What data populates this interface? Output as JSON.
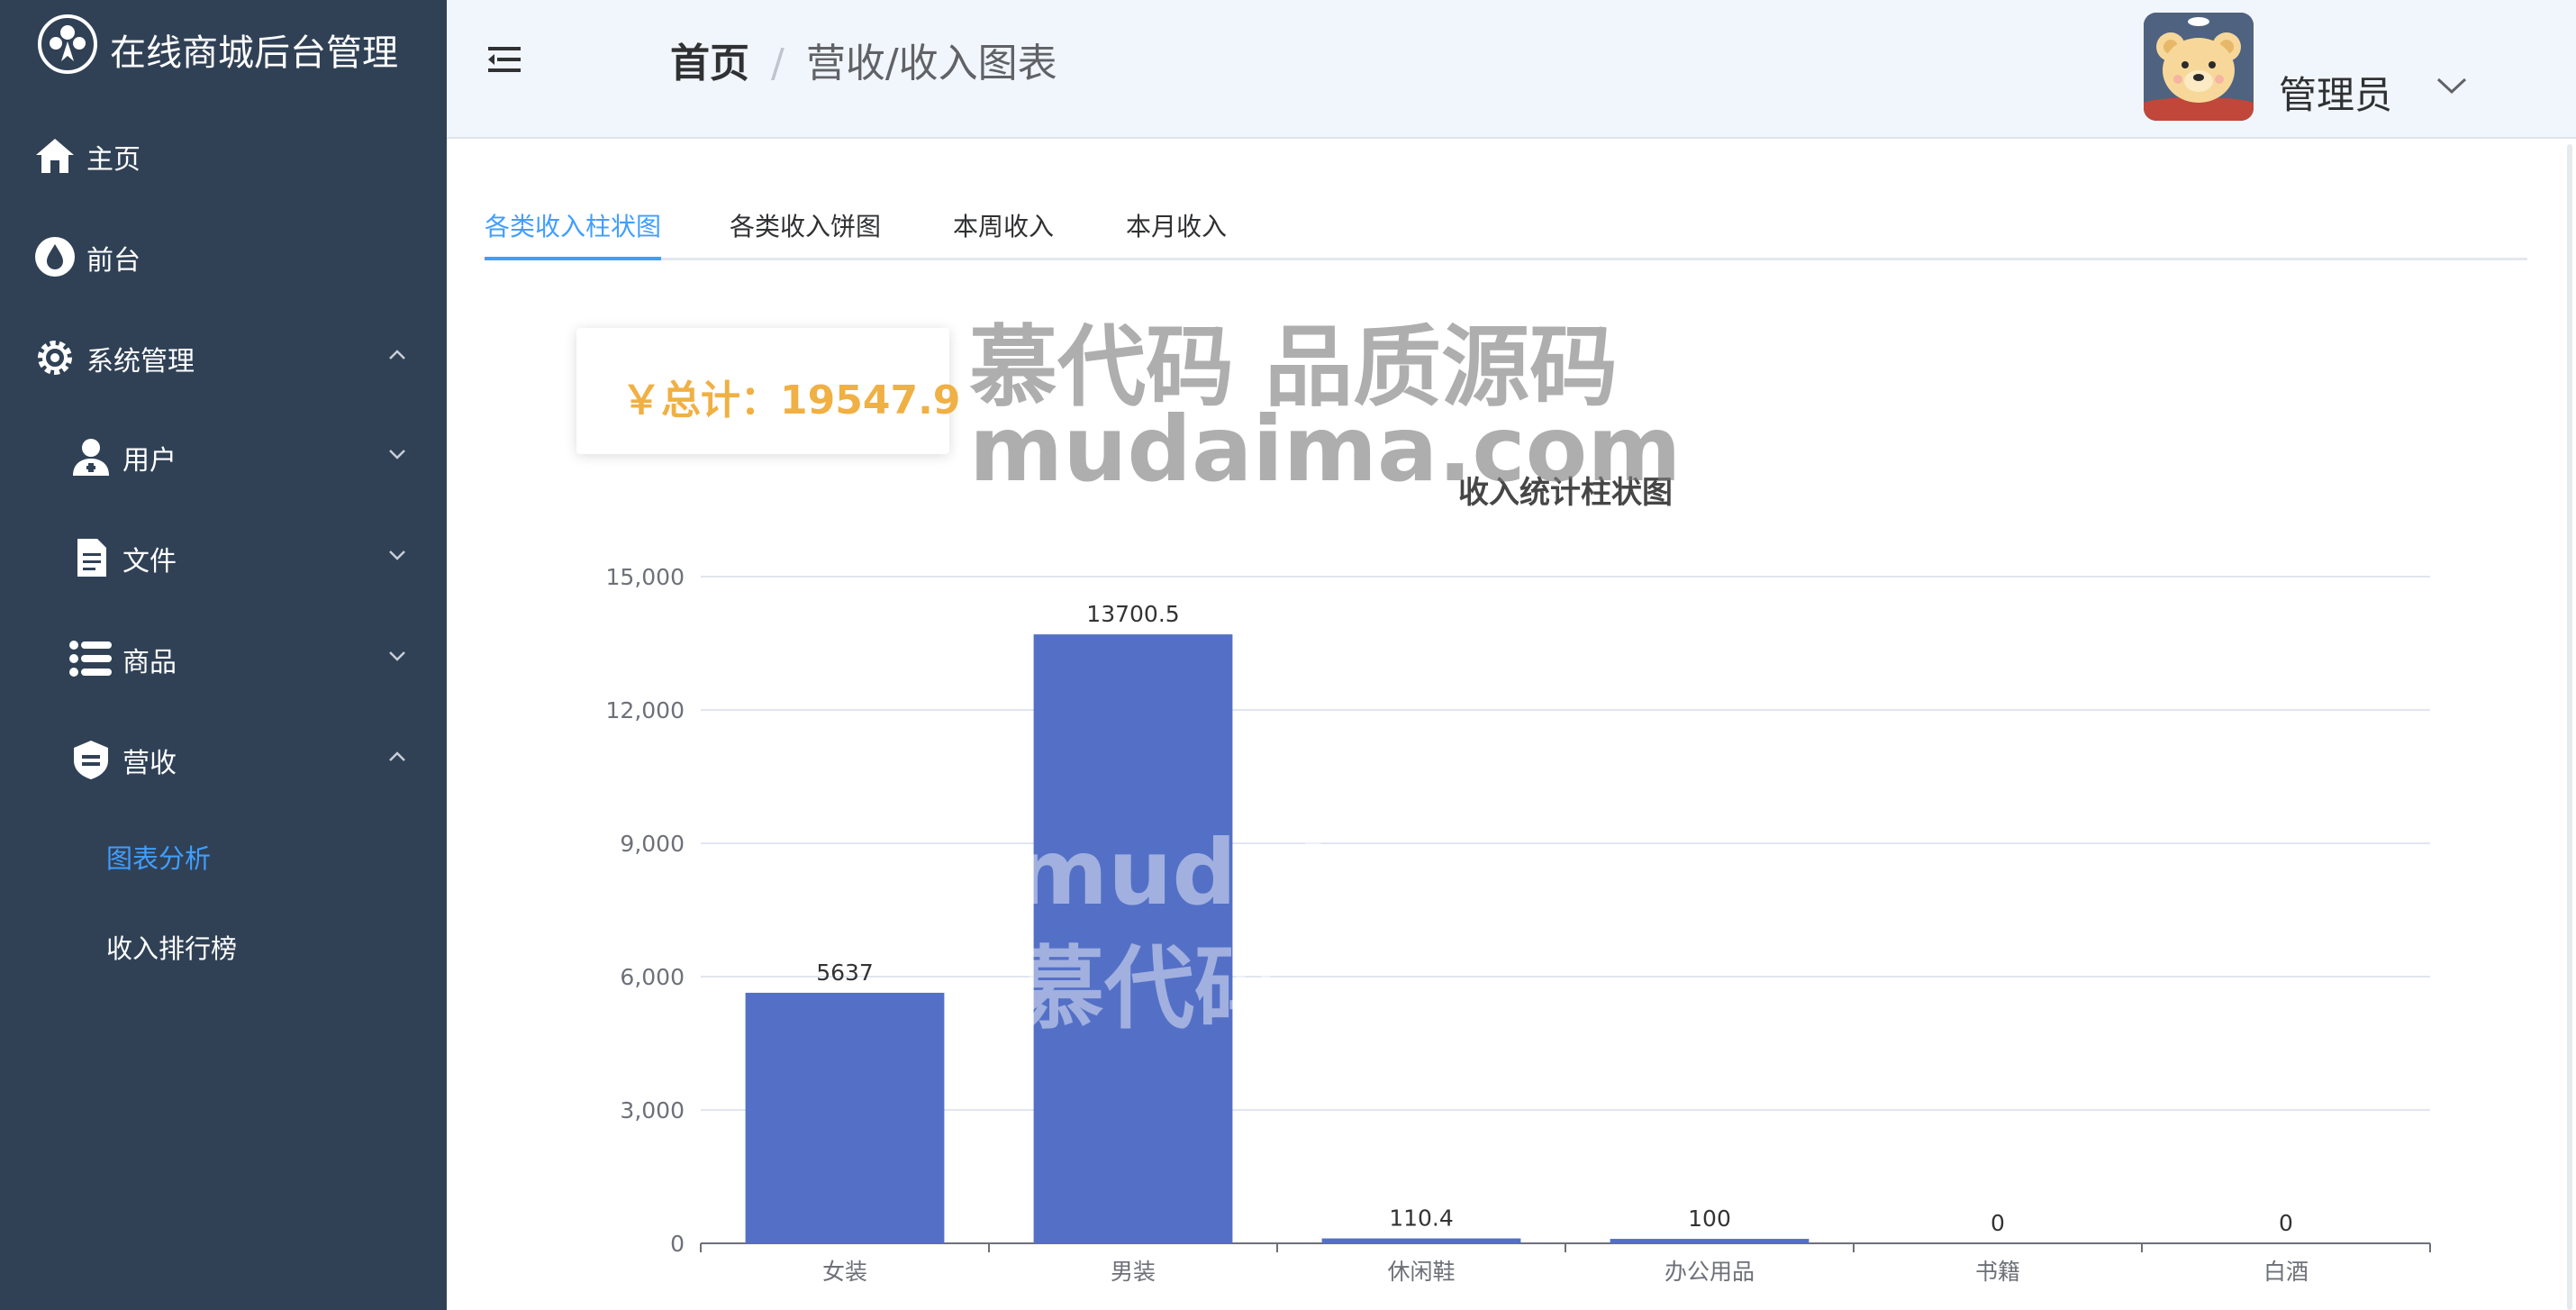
{
  "brand": {
    "title": "在线商城后台管理",
    "logo_icon": "paw-logo-icon"
  },
  "sidebar": {
    "items": [
      {
        "label": "主页",
        "icon": "home-icon"
      },
      {
        "label": "前台",
        "icon": "drop-icon"
      },
      {
        "label": "系统管理",
        "icon": "gear-icon",
        "expanded": true
      },
      {
        "label": "用户",
        "icon": "user-icon",
        "expanded": false
      },
      {
        "label": "文件",
        "icon": "document-icon",
        "expanded": false
      },
      {
        "label": "商品",
        "icon": "list-icon",
        "expanded": false
      },
      {
        "label": "营收",
        "icon": "shield-icon",
        "expanded": true
      }
    ],
    "sub_items": [
      {
        "label": "图表分析",
        "active": true
      },
      {
        "label": "收入排行榜",
        "active": false
      }
    ]
  },
  "header": {
    "breadcrumb_home": "首页",
    "breadcrumb_sep": "/",
    "breadcrumb_current": "营收/收入图表",
    "user_name": "管理员"
  },
  "tabs": [
    {
      "label": "各类收入柱状图",
      "active": true
    },
    {
      "label": "各类收入饼图",
      "active": false
    },
    {
      "label": "本周收入",
      "active": false
    },
    {
      "label": "本月收入",
      "active": false
    }
  ],
  "total": {
    "text": "￥总计：19547.9"
  },
  "watermark": {
    "line1": "慕代码 品质源码",
    "line2": "mudaima.com",
    "line3": "mudai",
    "line4": "慕代码"
  },
  "colors": {
    "sidebar_bg": "#304156",
    "accent": "#409eff",
    "bar": "#5470c6",
    "total_text": "#f0b044",
    "header_bg": "#f1f6fd"
  },
  "chart_data": {
    "type": "bar",
    "title": "收入统计柱状图",
    "categories": [
      "女装",
      "男装",
      "休闲鞋",
      "办公用品",
      "书籍",
      "白酒"
    ],
    "values": [
      5637,
      13700.5,
      110.4,
      100,
      0,
      0
    ],
    "data_labels": [
      "5637",
      "13700.5",
      "110.4",
      "100",
      "0",
      "0"
    ],
    "ylim": [
      0,
      15000
    ],
    "yticks": [
      0,
      3000,
      6000,
      9000,
      12000,
      15000
    ],
    "ytick_labels": [
      "0",
      "3,000",
      "6,000",
      "9,000",
      "12,000",
      "15,000"
    ],
    "grid": true,
    "xlabel": "",
    "ylabel": ""
  }
}
